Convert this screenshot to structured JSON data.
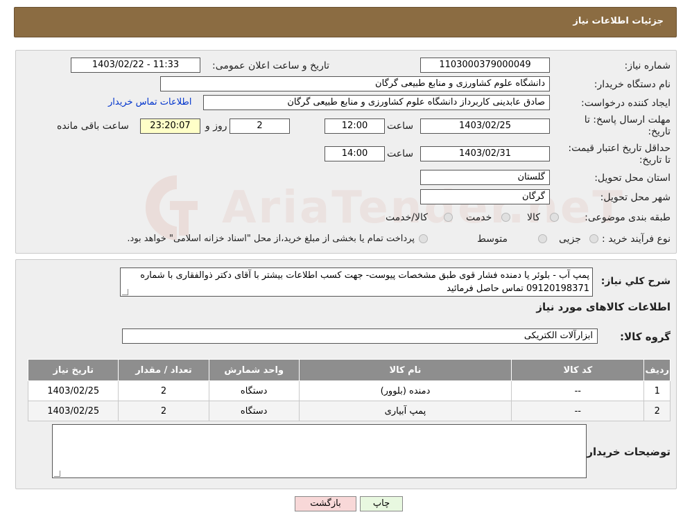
{
  "header": {
    "title": "جزئیات اطلاعات نیاز"
  },
  "labels": {
    "need_number": "شماره نیاز:",
    "announce_datetime": "تاریخ و ساعت اعلان عمومی:",
    "buyer_org": "نام دستگاه خریدار:",
    "requester": "ایجاد کننده درخواست:",
    "buyer_contact": "اطلاعات تماس خریدار",
    "reply_deadline": "مهلت ارسال پاسخ: تا تاریخ:",
    "time": "ساعت",
    "days_and": "روز و",
    "time_remaining": "ساعت باقی مانده",
    "price_validity": "حداقل تاریخ اعتبار قیمت: تا تاریخ:",
    "delivery_province": "استان محل تحویل:",
    "delivery_city": "شهر محل تحویل:",
    "category": "طبقه بندی موضوعی:",
    "process_type": "نوع فرآیند خرید :",
    "description": "شرح کلي نياز:",
    "items_section": "اطلاعات کالاهای مورد نیاز",
    "goods_group": "گروه کالا:",
    "buyer_notes": "توضیحات خریدار:"
  },
  "values": {
    "need_number": "1103000379000049",
    "announce_datetime": "1403/02/22 - 11:33",
    "buyer_org": "دانشگاه علوم کشاورزی و منابع طبیعی گرگان",
    "requester": "صادق عابدینی کاربرداز دانشگاه علوم کشاورزی و منابع طبیعی گرگان",
    "reply_date": "1403/02/25",
    "reply_time": "12:00",
    "days_left": "2",
    "time_left": "23:20:07",
    "price_date": "1403/02/31",
    "price_time": "14:00",
    "province": "گلستان",
    "city": "گرگان",
    "description": "پمپ آب - بلوئر یا دمنده فشار قوی طبق مشخصات پیوست- جهت کسب اطلاعات بیشتر با آقای دکتر ذوالفقاری با شماره 09120198371 تماس حاصل فرمائید",
    "goods_group": "ابزارآلات الکتریکی",
    "buyer_notes": ""
  },
  "category_options": [
    "کالا",
    "خدمت",
    "کالا/خدمت"
  ],
  "process_options": [
    "جزیی",
    "متوسط"
  ],
  "process_note": "پرداخت تمام یا بخشی از مبلغ خرید،از محل \"اسناد خزانه اسلامی\" خواهد بود.",
  "table": {
    "headers": [
      "ردیف",
      "کد کالا",
      "نام کالا",
      "واحد شمارش",
      "تعداد / مقدار",
      "تاریخ نیاز"
    ],
    "rows": [
      [
        "1",
        "--",
        "دمنده (بلوور)",
        "دستگاه",
        "2",
        "1403/02/25"
      ],
      [
        "2",
        "--",
        "پمپ آبیاری",
        "دستگاه",
        "2",
        "1403/02/25"
      ]
    ]
  },
  "buttons": {
    "print": "چاپ",
    "back": "بازگشت"
  },
  "watermark": "AriaTender.neT",
  "colors": {
    "header": "#8b6c42",
    "table_header": "#8e8e8e",
    "back_button": "#f8d8d8",
    "print_button": "#e8f8e0"
  }
}
